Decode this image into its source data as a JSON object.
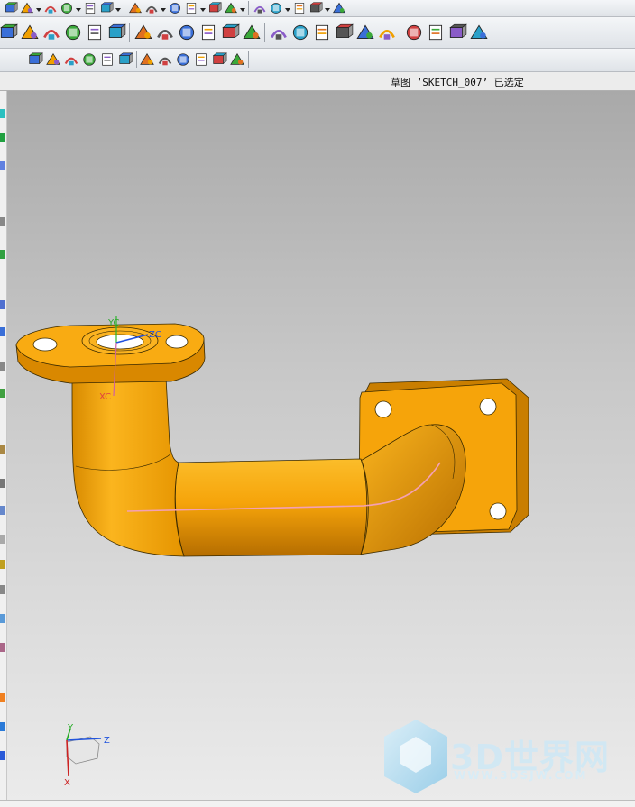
{
  "status": {
    "message": "草图 ’SKETCH_007’ 已选定"
  },
  "toolbars": {
    "row1": [
      "sketch-icon",
      "rotate-view-icon",
      "feature-icon",
      "hole-icon",
      "view-cube-icon",
      "shading-icon",
      "solid-icon",
      "box-icon",
      "color-icon",
      "frame-icon",
      "arrow-icon",
      "select-icon",
      "table-icon",
      "measure-icon",
      "diamond-icon",
      "wand-icon",
      "flag-icon"
    ],
    "row2": [
      "extrude-icon",
      "revolve-icon",
      "sweep-icon",
      "box-feature-icon",
      "shell-icon",
      "block-icon",
      "surface-icon",
      "fold-icon",
      "blend-icon",
      "chamfer-icon",
      "pocket-icon",
      "boss-icon",
      "move-face-icon",
      "offset-face-icon",
      "delete-face-icon",
      "replace-face-icon",
      "pattern-face-icon",
      "scale-icon",
      "mirror-icon",
      "trim-body-icon",
      "split-body-icon",
      "cylinder-icon"
    ],
    "row3": [
      "snap-icon",
      "point-snap-icon",
      "line-icon",
      "arc-icon",
      "curve-icon",
      "intersection-icon",
      "center-icon",
      "circle-snap-icon",
      "plus-icon",
      "tangent-icon",
      "pin-icon",
      "box-small-icon"
    ]
  },
  "model": {
    "axis_labels": {
      "yc": "YC",
      "xc": "XC",
      "zc": "ZC"
    }
  },
  "triad": {
    "x": "X",
    "y": "Y",
    "z": "Z"
  },
  "watermark": {
    "brand": "3D世界网",
    "url": "WWW.3DSJW.COM"
  },
  "colors": {
    "part": "#f6a40a",
    "part_dark": "#c97800",
    "viewport_top": "#a9a9a9",
    "viewport_bottom": "#ebebeb"
  }
}
